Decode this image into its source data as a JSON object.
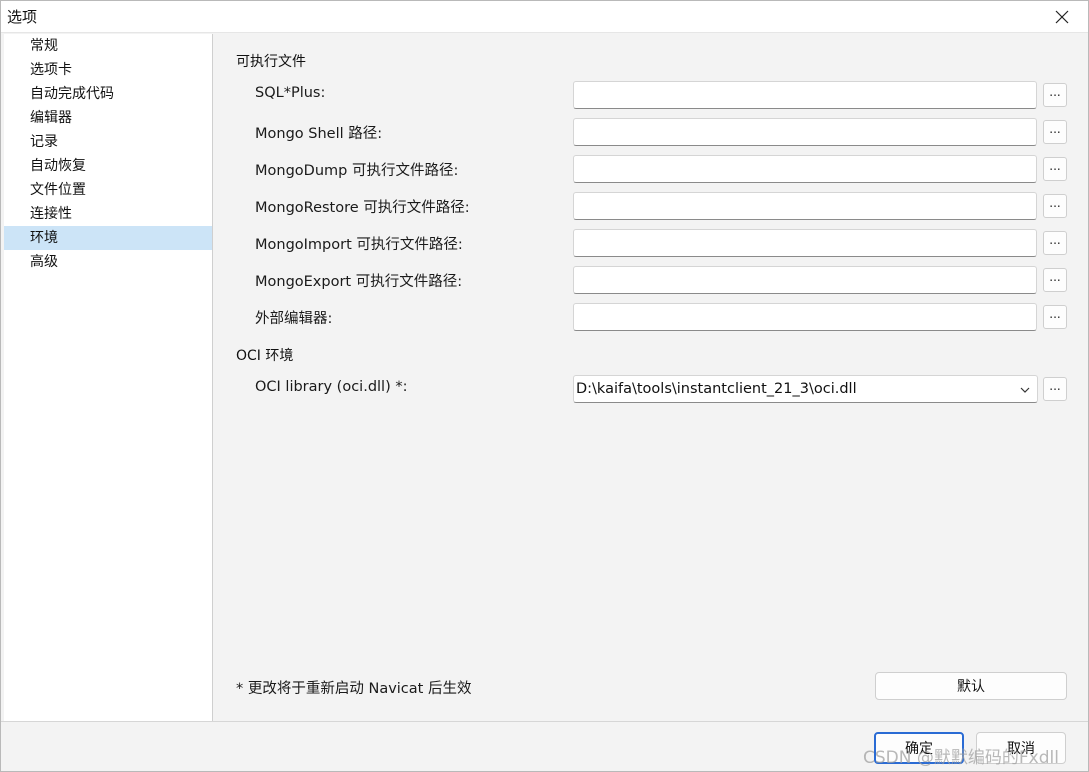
{
  "window": {
    "title": "选项"
  },
  "nav": {
    "items": [
      {
        "label": "常规"
      },
      {
        "label": "选项卡"
      },
      {
        "label": "自动完成代码"
      },
      {
        "label": "编辑器"
      },
      {
        "label": "记录"
      },
      {
        "label": "自动恢复"
      },
      {
        "label": "文件位置"
      },
      {
        "label": "连接性"
      },
      {
        "label": "环境"
      },
      {
        "label": "高级"
      }
    ],
    "selected": "环境"
  },
  "executables": {
    "section_title": "可执行文件",
    "rows": [
      {
        "label": "SQL*Plus:",
        "value": ""
      },
      {
        "label": "Mongo Shell 路径:",
        "value": ""
      },
      {
        "label": "MongoDump 可执行文件路径:",
        "value": ""
      },
      {
        "label": "MongoRestore 可执行文件路径:",
        "value": ""
      },
      {
        "label": "MongoImport 可执行文件路径:",
        "value": ""
      },
      {
        "label": "MongoExport 可执行文件路径:",
        "value": ""
      },
      {
        "label": "外部编辑器:",
        "value": ""
      }
    ],
    "browse_label": "..."
  },
  "oci": {
    "section_title": "OCI 环境",
    "label": "OCI library (oci.dll) *:",
    "value": "D:\\kaifa\\tools\\instantclient_21_3\\oci.dll",
    "browse_label": "..."
  },
  "note": "* 更改将于重新启动 Navicat 后生效",
  "buttons": {
    "default": "默认",
    "ok": "确定",
    "cancel": "取消"
  },
  "watermark": "CSDN @默默编码的Fxdll"
}
